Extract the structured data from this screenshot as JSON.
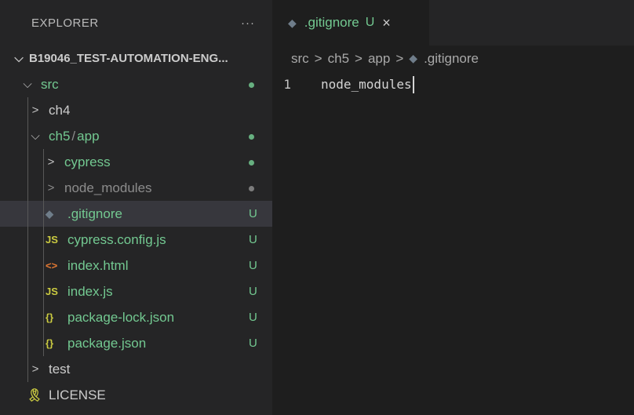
{
  "explorer": {
    "title": "EXPLORER",
    "more": "···",
    "workspace": "B19046_TEST-AUTOMATION-ENG...",
    "tree": [
      {
        "label": "src",
        "badge": "dot"
      },
      {
        "label": "ch4",
        "badge": ""
      },
      {
        "label": "ch5",
        "sub": "app",
        "badge": "dot"
      },
      {
        "label": "cypress",
        "badge": "dot"
      },
      {
        "label": "node_modules",
        "badge": "dot"
      },
      {
        "label": ".gitignore",
        "badge": "U"
      },
      {
        "label": "cypress.config.js",
        "badge": "U",
        "icon": "JS"
      },
      {
        "label": "index.html",
        "badge": "U",
        "icon": "<>"
      },
      {
        "label": "index.js",
        "badge": "U",
        "icon": "JS"
      },
      {
        "label": "package-lock.json",
        "badge": "U",
        "icon": "{}"
      },
      {
        "label": "package.json",
        "badge": "U",
        "icon": "{}"
      },
      {
        "label": "test",
        "badge": ""
      },
      {
        "label": "LICENSE",
        "badge": ""
      }
    ]
  },
  "editor": {
    "tab": {
      "name": ".gitignore",
      "badge": "U",
      "close": "×"
    },
    "breadcrumb": [
      "src",
      "ch5",
      "app",
      ".gitignore"
    ],
    "lines": [
      {
        "num": "1",
        "text": "node_modules"
      }
    ]
  },
  "colors": {
    "untracked": "#73c991",
    "ignored": "#8c8c8c",
    "html_icon": "#e37933",
    "js_icon": "#cbcb41",
    "json_icon": "#cbcb41",
    "license_icon": "#cbcb41"
  }
}
